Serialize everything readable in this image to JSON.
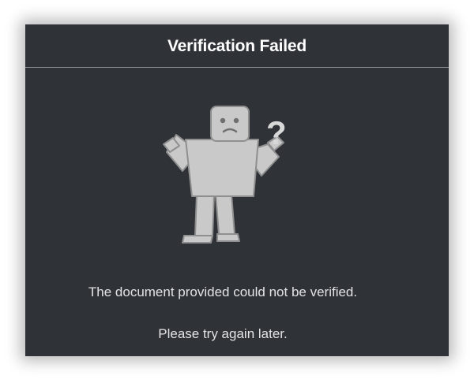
{
  "dialog": {
    "title": "Verification Failed",
    "illustration_icon": "confused-character-icon",
    "message": "The document provided could not be verified.",
    "submessage": "Please try again later."
  },
  "colors": {
    "dialog_background": "#2f3236",
    "title_text": "#ffffff",
    "body_text": "#e2e3e5",
    "divider": "#8a8d91",
    "figure_fill": "#c9c9c9"
  }
}
